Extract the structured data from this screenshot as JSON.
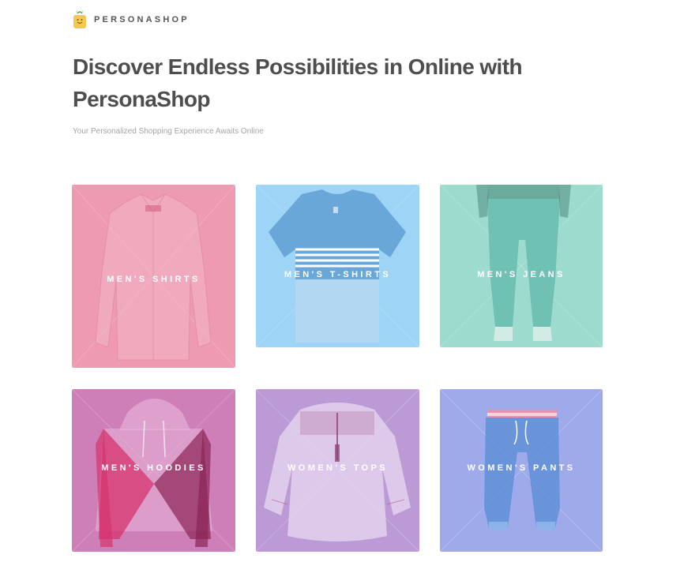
{
  "brand": {
    "name": "PERSONASHOP",
    "logo_icon": "shopping-bag-icon",
    "logo_color": "#f6c84a"
  },
  "hero": {
    "title": "Discover Endless Possibilities in Online with PersonaShop",
    "subtitle": "Your Personalized Shopping Experience Awaits Online"
  },
  "categories": [
    {
      "label": "MEN'S SHIRTS",
      "image": "shirt-image",
      "color": "#ee9bb1"
    },
    {
      "label": "MEN'S T-SHIRTS",
      "image": "tshirt-image",
      "color": "#9ed4f5"
    },
    {
      "label": "MEN'S JEANS",
      "image": "jeans-image",
      "color": "#9ddbcf"
    },
    {
      "label": "MEN'S HOODIES",
      "image": "hoodie-image",
      "color": "#cf7fb8"
    },
    {
      "label": "WOMEN'S TOPS",
      "image": "blouse-image",
      "color": "#bb9ad5"
    },
    {
      "label": "WOMEN'S PANTS",
      "image": "pants-image",
      "color": "#9eaaea"
    }
  ]
}
